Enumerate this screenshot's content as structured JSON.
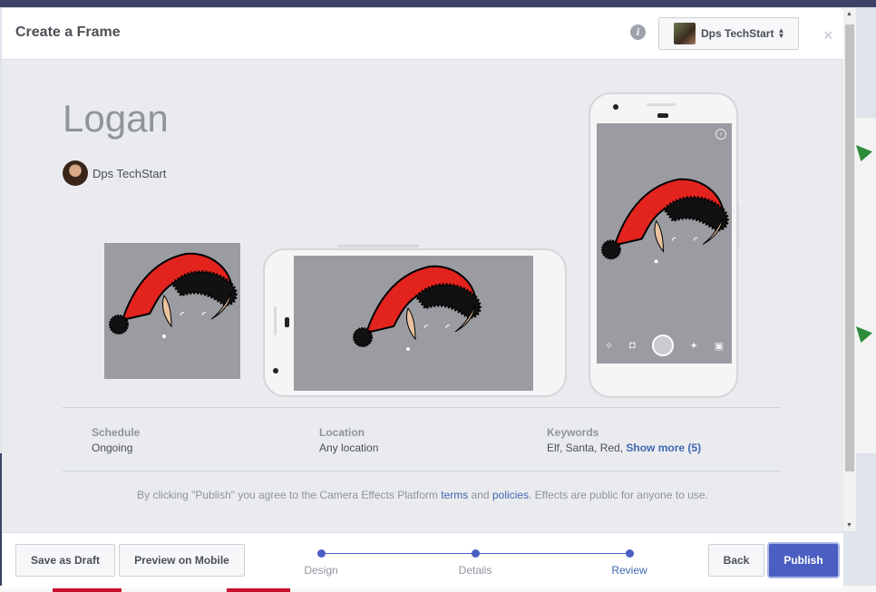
{
  "modal": {
    "title": "Create a Frame",
    "account": "Dps TechStart",
    "close": "×",
    "info": "i"
  },
  "effect": {
    "name": "Logan",
    "author": "Dps TechStart"
  },
  "details": {
    "schedule_label": "Schedule",
    "schedule_value": "Ongoing",
    "location_label": "Location",
    "location_value": "Any location",
    "keywords_label": "Keywords",
    "keywords_value": "Elf, Santa, Red,",
    "keywords_more": "Show more (5)"
  },
  "terms": {
    "prefix": "By clicking \"Publish\" you agree to the Camera Effects Platform",
    "terms_link": "terms",
    "and": "and",
    "policies_link": "policies",
    "suffix": ". Effects are public for anyone to use."
  },
  "footer": {
    "save_draft": "Save as Draft",
    "preview_mobile": "Preview on Mobile",
    "back": "Back",
    "publish": "Publish",
    "steps": [
      "Design",
      "Details",
      "Review"
    ],
    "current_step": "Review"
  },
  "colors": {
    "accent": "#4b5ec1",
    "link": "#4267b2",
    "hat_red": "#e3231e",
    "ear": "#e8c39d"
  }
}
